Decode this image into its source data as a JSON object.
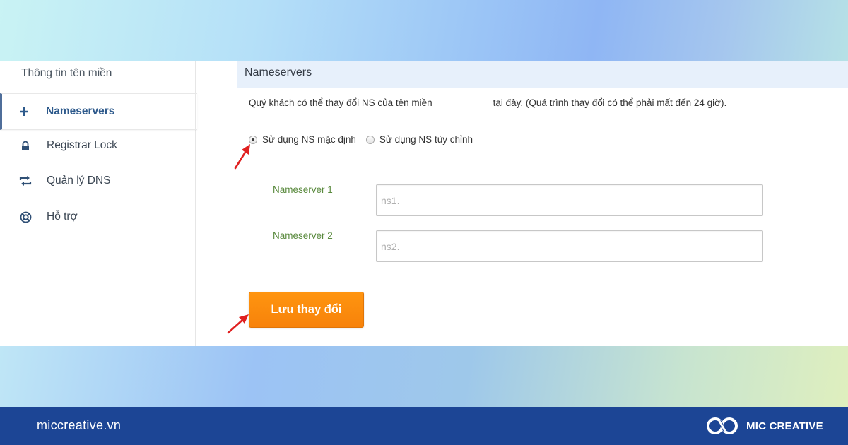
{
  "sidebar": {
    "header": "Thông tin tên miền",
    "items": [
      {
        "label": "Nameservers",
        "icon": "plus-icon",
        "active": true
      },
      {
        "label": "Registrar Lock",
        "icon": "lock-icon"
      },
      {
        "label": "Quản lý DNS",
        "icon": "refresh-icon"
      },
      {
        "label": "Hỗ trợ",
        "icon": "lifebuoy-icon"
      }
    ]
  },
  "panel": {
    "title": "Nameservers",
    "description_part1": "Quý khách có thể thay đổi NS của tên miền",
    "description_part2": "tại đây. (Quá trình thay đổi có thể phải mất đến 24 giờ).",
    "radio_default": "Sử dụng NS mặc định",
    "radio_custom": "Sử dụng NS tùy chỉnh",
    "fields": [
      {
        "label": "Nameserver 1",
        "placeholder": "ns1."
      },
      {
        "label": "Nameserver 2",
        "placeholder": "ns2."
      }
    ],
    "save_label": "Lưu thay đổi"
  },
  "footer": {
    "domain": "miccreative.vn",
    "brand": "MIC CREATIVE"
  },
  "colors": {
    "accent_orange": "#f7820a",
    "footer_blue": "#1c4595",
    "arrow_red": "#e02020",
    "label_green": "#5a8a3e"
  }
}
